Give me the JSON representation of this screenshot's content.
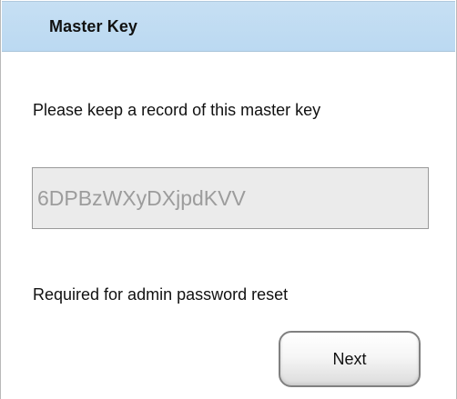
{
  "dialog": {
    "title": "Master Key",
    "prompt": "Please keep a record of this master key",
    "master_key": "6DPBzWXyDXjpdKVV",
    "note": "Required for admin password reset",
    "next_label": "Next"
  },
  "colors": {
    "title_bar_bg": "#c2dcf2",
    "field_bg": "#ebebeb",
    "field_text": "#9c9c9c"
  }
}
